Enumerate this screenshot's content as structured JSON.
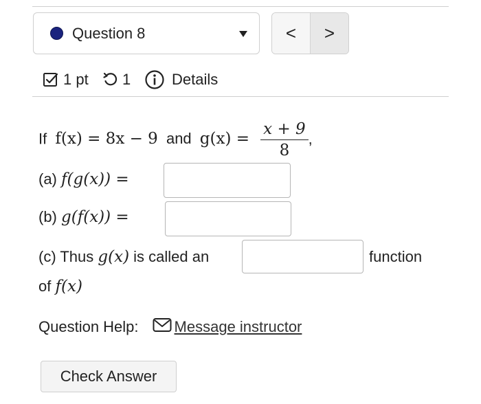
{
  "header": {
    "question_label": "Question 8",
    "prev_glyph": "<",
    "next_glyph": ">"
  },
  "meta": {
    "points": "1 pt",
    "attempts": "1",
    "details": "Details"
  },
  "problem": {
    "intro_if": "If",
    "f_def": "f(x) = 8x − 9",
    "and": "and",
    "g_lhs": "g(x) =",
    "g_num": "x + 9",
    "g_den": "8",
    "comma": ",",
    "part_a_label": "(a)",
    "part_a_expr": "f(g(x)) =",
    "part_b_label": "(b)",
    "part_b_expr": "g(f(x)) =",
    "part_c_prefix": "(c) Thus",
    "part_c_gx": "g(x)",
    "part_c_mid": "is called an",
    "part_c_suffix": "function",
    "part_c_of": "of",
    "part_c_fx": "f(x)"
  },
  "answers": {
    "a": "",
    "b": "",
    "c": ""
  },
  "help": {
    "label": "Question Help:",
    "link": "Message instructor"
  },
  "actions": {
    "check_answer": "Check Answer"
  },
  "colors": {
    "status_dot": "#1a237e",
    "border": "#cfcfcf"
  },
  "icons": [
    "checkbox-icon",
    "retry-icon",
    "info-icon",
    "mail-icon",
    "chevron-down-icon"
  ]
}
